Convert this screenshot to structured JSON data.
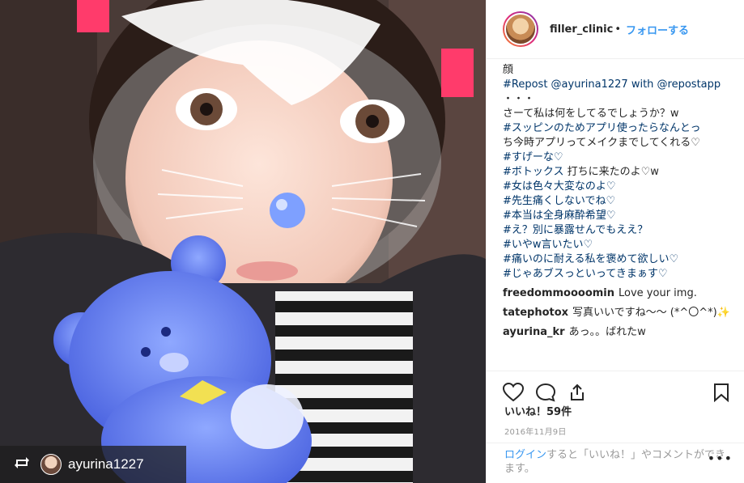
{
  "post": {
    "username": "filler_clinic",
    "dot": "•",
    "follow_label": "フォローする",
    "caption": [
      {
        "text": "顔",
        "tag": false
      },
      {
        "text": "#Repost @ayurina1227 with @repostapp",
        "tag": true
      },
      {
        "text": "・・・",
        "tag": false
      },
      {
        "text": "さーて私は何をしてるでしょうか？w",
        "tag": false
      },
      {
        "text": "#スッピンのためアプリ使ったらなんとっ",
        "tag": true
      },
      {
        "text": "ち今時アプリってメイクまでしてくれる♡",
        "tag": false
      },
      {
        "text": "#すげーな♡",
        "tag": true
      },
      {
        "text": "#ボトックス",
        "tag": true,
        "suffix": " 打ちに来たのよ♡w"
      },
      {
        "text": "#女は色々大変なのよ♡",
        "tag": true
      },
      {
        "text": "#先生痛くしないでね♡",
        "tag": true
      },
      {
        "text": "#本当は全身麻酔希望♡",
        "tag": true
      },
      {
        "text": "#え？別に暴露せんでもええ？",
        "tag": true
      },
      {
        "text": "#いやw言いたい♡",
        "tag": true
      },
      {
        "text": "#痛いのに耐える私を褒めて欲しい♡",
        "tag": true
      },
      {
        "text": "#じゃあブスっといってきまぁす♡",
        "tag": true
      }
    ],
    "comments": [
      {
        "user": "freedommoooomin",
        "text": "Love your img."
      },
      {
        "user": "tatephotox",
        "text": "写真いいですね～～ (*^〇^*)✨"
      },
      {
        "user": "ayurina_kr",
        "text": "あっ。。ばれたw"
      }
    ],
    "likes": "いいね！59件",
    "date": "2016年11月9日",
    "login_link": "ログイン",
    "login_text": "すると「いいね！」やコメントができます。",
    "more": "•••"
  },
  "repost": {
    "username": "ayurina1227"
  },
  "icons": [
    "heart-icon",
    "comment-icon",
    "share-icon",
    "bookmark-icon",
    "repost-icon"
  ],
  "colors": {
    "accent": "#3897f0",
    "tag": "#003569",
    "muted": "#999999"
  }
}
